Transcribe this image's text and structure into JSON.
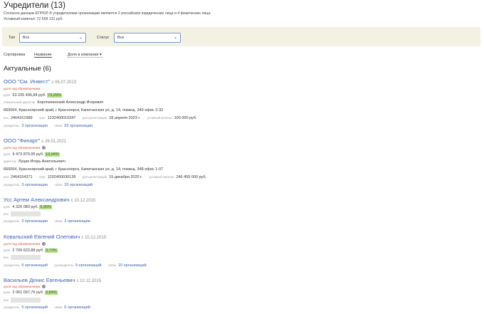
{
  "header": {
    "title": "Учредители (13)",
    "note": "Согласно данным ЕГРЮЛ ® учредителями организации являются 2 российских юридических лица и 4 физических лица.",
    "capital": "Уставный капитал: 72 658 131 руб."
  },
  "filters": {
    "type_label": "Тип",
    "type_value": "Все",
    "status_label": "Статус",
    "status_value": "Все"
  },
  "sort": {
    "label": "Сортировка",
    "by_name": "Название",
    "by_share": "Доля в компании ▾"
  },
  "section": {
    "title": "Актуальные (6)"
  },
  "founders": [
    {
      "name": "ООО \"См. Инвест\"",
      "since": "с 06.07.2023",
      "restriction": "доля под обременением",
      "share_label": "доля",
      "share": "53 226 496,84 руб.",
      "pct": "73,26%",
      "director_role": "генеральный директор",
      "director": "Коропачинский Александр Игоревич",
      "address": "660064, Красноярский край, г Красноярск, Капитанская ул, д. 14, помещ. 349 офис 2-32",
      "inn_label": "инн",
      "inn": "2464161989",
      "ogrn_label": "огрн",
      "ogrn": "1232400010347",
      "reg_label": "дата регистрации",
      "reg": "18 апреля 2023 г.",
      "cap_label": "уставный капитал",
      "cap": "100 000 руб.",
      "founder_label": "учредитель",
      "founder_link": "3 организации",
      "links_label": "связи",
      "links_link": "93 организации"
    },
    {
      "name": "ООО \"Финарт\"",
      "since": "с 26.01.2021",
      "restriction": "доля под обременением",
      "share_label": "доля",
      "share": "9 473 879,95 руб.",
      "pct": "13,04%",
      "director_role": "директор",
      "director": "Луцик Игорь Анатольевич",
      "address": "660064, Красноярский край, г Красноярск, Капитанская ул, д. 14, помещ. 348 офис 1-07",
      "inn_label": "инн",
      "inn": "2464154371",
      "ogrn_label": "огрн",
      "ogrn": "1202400030139",
      "reg_label": "дата регистрации",
      "reg": "15 декабря 2020 г.",
      "cap_label": "уставный капитал",
      "cap": "246 459 000 руб.",
      "founder_label": "учредитель",
      "founder_link": "3 организации",
      "links_label": "связи",
      "links_link": "20 организаций"
    },
    {
      "name": "Усс Артем Александрович",
      "since": "с 10.12.2015",
      "share_label": "доля",
      "share": "4 326 080 руб.",
      "pct": "5,95%",
      "inn_label": "инн",
      "founder_label": "учредитель",
      "founder_link": "3 организации",
      "links_label": "связи",
      "links_link": "3 организации"
    },
    {
      "name": "Ковальский Евгений Олегович",
      "since": "с 10.12.2015",
      "restriction": "доля под обременением",
      "share_label": "доля",
      "share": "2 709 622,88 руб.",
      "pct": "3,73%",
      "inn_label": "инн",
      "founder_label": "учредитель",
      "founder_link": "5 организаций",
      "head_label": "руководитель",
      "head_link": "5 организаций",
      "links_label": "связи",
      "links_link": "10 организаций"
    },
    {
      "name": "Васильев Денис Евгеньевич",
      "since": "с 10.12.2015",
      "restriction": "доля под обременением",
      "share_label": "доля",
      "share": "2 061 097,76 руб.",
      "pct": "2,84%",
      "inn_label": "инн",
      "founder_label": "учредитель",
      "founder_link": "5 организаций",
      "links_label": "связи",
      "links_link": "6 организаций"
    }
  ]
}
